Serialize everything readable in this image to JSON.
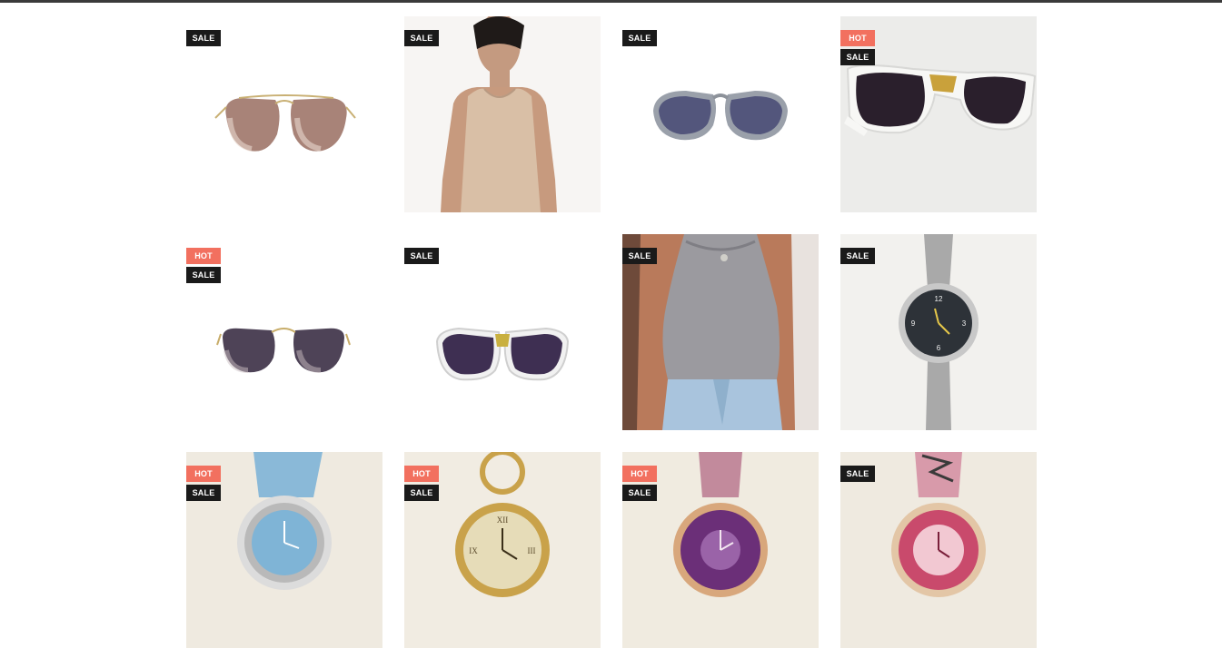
{
  "header": {
    "bar_color": "#3a3a3a"
  },
  "badge_colors": {
    "hot": "#f2705f",
    "sale": "#1a1a1a"
  },
  "products": [
    {
      "kind": "sunglasses-rose-gold",
      "badges": [
        "SALE"
      ],
      "bg": "#ffffff"
    },
    {
      "kind": "beige-tank-top",
      "badges": [
        "SALE"
      ],
      "bg": "#ffffff"
    },
    {
      "kind": "sunglasses-grey",
      "badges": [
        "SALE"
      ],
      "bg": "#ffffff"
    },
    {
      "kind": "sunglasses-white-frame",
      "badges": [
        "HOT",
        "SALE"
      ],
      "bg": "#ececea"
    },
    {
      "kind": "sunglasses-purple-metal",
      "badges": [
        "HOT",
        "SALE"
      ],
      "bg": "#ffffff"
    },
    {
      "kind": "sunglasses-white-purple",
      "badges": [
        "SALE"
      ],
      "bg": "#ffffff"
    },
    {
      "kind": "grey-halter-bodysuit",
      "badges": [
        "SALE"
      ],
      "bg": "#ffffff"
    },
    {
      "kind": "silver-bracelet-watch",
      "badges": [
        "SALE"
      ],
      "bg": "#f2f1ee"
    },
    {
      "kind": "blue-strap-watch",
      "badges": [
        "HOT",
        "SALE"
      ],
      "bg": "#efeae0"
    },
    {
      "kind": "gold-ring-watch",
      "badges": [
        "HOT",
        "SALE"
      ],
      "bg": "#f1ece2"
    },
    {
      "kind": "pink-strap-purple-watch",
      "badges": [
        "HOT",
        "SALE"
      ],
      "bg": "#f0ebe0"
    },
    {
      "kind": "pink-flower-watch",
      "badges": [
        "SALE"
      ],
      "bg": "#efeae0"
    }
  ]
}
